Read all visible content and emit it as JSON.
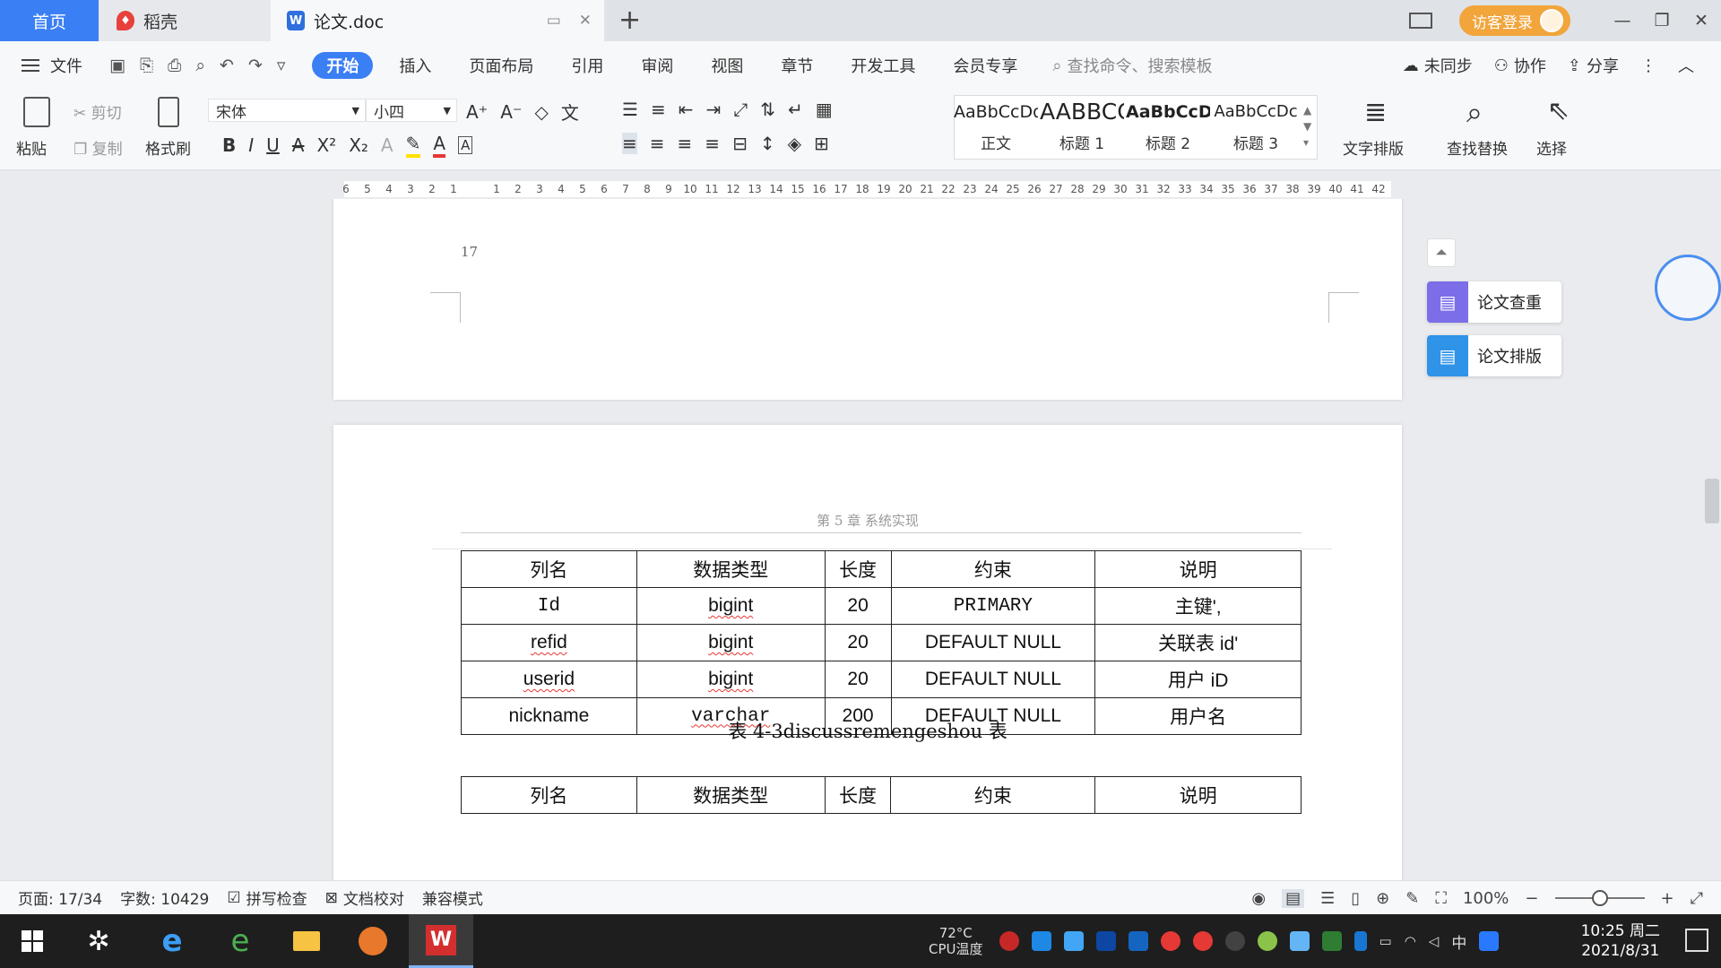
{
  "tabs": {
    "home": "首页",
    "daoke": "稻壳",
    "document": "论文.doc",
    "new_tab": "+"
  },
  "titlebar": {
    "login": "访客登录",
    "minimize": "—",
    "restore": "❐",
    "close": "✕"
  },
  "menu": {
    "file": "文件",
    "items": [
      "开始",
      "插入",
      "页面布局",
      "引用",
      "审阅",
      "视图",
      "章节",
      "开发工具",
      "会员专享"
    ],
    "search": "查找命令、搜索模板",
    "sync": "未同步",
    "collab": "协作",
    "share": "分享"
  },
  "ribbon": {
    "paste": "粘贴",
    "cut": "剪切",
    "copy": "复制",
    "format_painter": "格式刷",
    "font_name": "宋体",
    "font_size": "小四",
    "styles": [
      {
        "sample": "AaBbCcDd",
        "name": "正文"
      },
      {
        "sample": "AABBCC",
        "name": "标题 1"
      },
      {
        "sample": "AaBbCcD",
        "name": "标题 2"
      },
      {
        "sample": "AaBbCcDc",
        "name": "标题 3"
      }
    ],
    "text_layout": "文字排版",
    "find_replace": "查找替换",
    "select": "选择"
  },
  "ruler": {
    "left_ticks": [
      "6",
      "5",
      "4",
      "3",
      "2",
      "1"
    ],
    "right_ticks": [
      "1",
      "2",
      "3",
      "4",
      "5",
      "6",
      "7",
      "8",
      "9",
      "10",
      "11",
      "12",
      "13",
      "14",
      "15",
      "16",
      "17",
      "18",
      "19",
      "20",
      "21",
      "22",
      "23",
      "24",
      "25",
      "26",
      "27",
      "28",
      "29",
      "30",
      "31",
      "32",
      "33",
      "34",
      "35",
      "36",
      "37",
      "38",
      "39",
      "40",
      "41",
      "42"
    ]
  },
  "document": {
    "page_number": "17",
    "running_header": "第 5 章  系统实现",
    "table1": {
      "headers": [
        "列名",
        "数据类型",
        "长度",
        "约束",
        "说明"
      ],
      "rows": [
        [
          "Id",
          "bigint",
          "20",
          "PRIMARY",
          "主键',"
        ],
        [
          "refid",
          "bigint",
          "20",
          "DEFAULT NULL",
          "关联表 id'"
        ],
        [
          "userid",
          "bigint",
          "20",
          "DEFAULT NULL",
          "用户 iD"
        ],
        [
          "nickname",
          "varchar",
          "200",
          "DEFAULT NULL",
          "用户名"
        ]
      ]
    },
    "caption": "表 4-3discussremengeshou 表",
    "table2": {
      "headers": [
        "列名",
        "数据类型",
        "长度",
        "约束",
        "说明"
      ]
    }
  },
  "side_panel": {
    "plagiarism": "论文查重",
    "formatting": "论文排版"
  },
  "status": {
    "page": "页面: 17/34",
    "words": "字数: 10429",
    "spell": "拼写检查",
    "proof": "文档校对",
    "compat": "兼容模式",
    "zoom": "100%",
    "zoom_fraction": 0.5
  },
  "taskbar": {
    "cpu_temp": "72°C",
    "cpu_label": "CPU温度",
    "ime": "中",
    "time": "10:25 周二",
    "date": "2021/8/31"
  },
  "colors": {
    "accent": "#3b7ff5",
    "login": "#f1a53b",
    "wps_red": "#d32f2f"
  }
}
